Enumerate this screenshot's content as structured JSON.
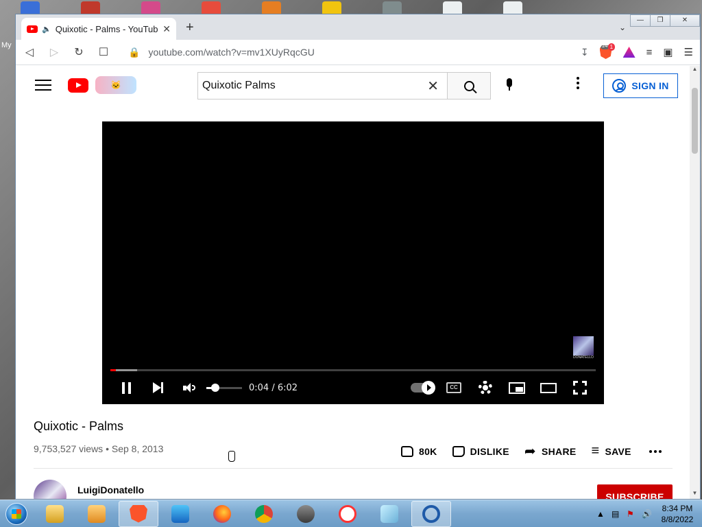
{
  "desktop": {
    "label": "My"
  },
  "browser": {
    "tab": {
      "title": "Quixotic - Palms - YouTube"
    },
    "url": "youtube.com/watch?v=mv1XUyRqcGU",
    "shields_count": "14",
    "rewards_count": "1"
  },
  "youtube": {
    "search_value": "Quixotic Palms",
    "sign_in": "SIGN IN",
    "player": {
      "time": "0:04 / 6:02",
      "progress_fraction": 0.011,
      "buffered_fraction": 0.055,
      "volume_fraction": 0.25,
      "watermark": "DONATELLO"
    },
    "video": {
      "title": "Quixotic - Palms",
      "meta": "9,753,527 views • Sep 8, 2013",
      "likes": "80K",
      "dislike": "DISLIKE",
      "share": "SHARE",
      "save": "SAVE"
    },
    "channel": {
      "name": "LuigiDonatello",
      "subscribe": "SUBSCRIBE"
    }
  },
  "taskbar": {
    "time": "8:34 PM",
    "date": "8/8/2022",
    "apps": [
      "file-explorer",
      "media-player",
      "brave",
      "wps",
      "firefox",
      "chrome",
      "raccoon-app",
      "yandex",
      "notepad",
      "active-app"
    ]
  },
  "colors": {
    "youtube_red": "#ff0000",
    "link_blue": "#065fd4",
    "subscribe_red": "#cc0000"
  }
}
